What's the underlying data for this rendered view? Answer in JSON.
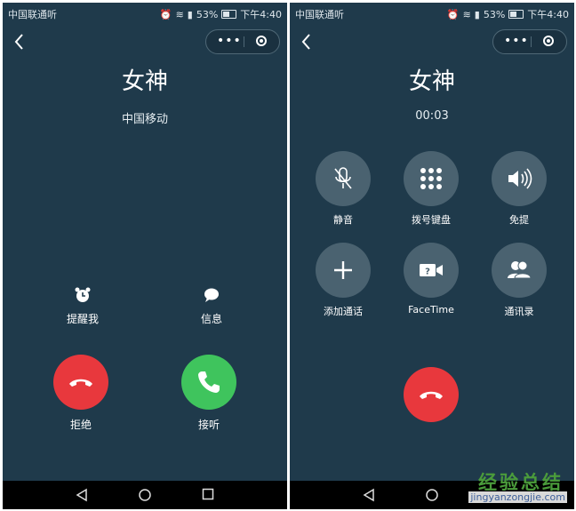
{
  "status": {
    "carrier": "中国联通听",
    "battery": "53%",
    "time": "下午4:40"
  },
  "left": {
    "contact_name": "女神",
    "carrier": "中国移动",
    "remind_label": "提醒我",
    "message_label": "信息",
    "decline_label": "拒绝",
    "answer_label": "接听"
  },
  "right": {
    "contact_name": "女神",
    "timer": "00:03",
    "buttons": [
      {
        "label": "静音",
        "icon": "mute-icon"
      },
      {
        "label": "拨号键盘",
        "icon": "keypad-icon"
      },
      {
        "label": "免提",
        "icon": "speaker-icon"
      },
      {
        "label": "添加通话",
        "icon": "plus-icon"
      },
      {
        "label": "FaceTime",
        "icon": "facetime-icon"
      },
      {
        "label": "通讯录",
        "icon": "contacts-icon"
      }
    ]
  },
  "watermark": {
    "title": "经验总结",
    "url": "jingyanzongjie.com"
  },
  "colors": {
    "background": "#1f3a4b",
    "decline": "#e8383d",
    "answer": "#3fc45d",
    "control": "#4a6270"
  }
}
